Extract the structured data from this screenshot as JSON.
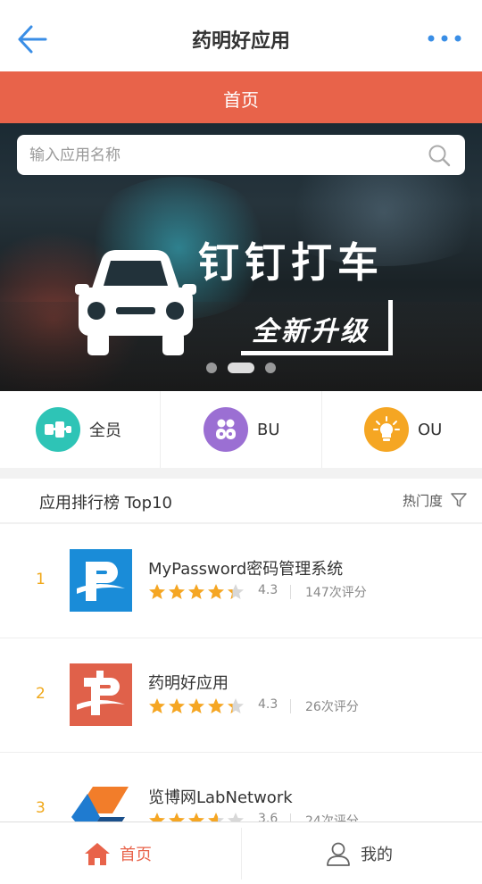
{
  "header": {
    "title": "药明好应用",
    "back_icon": "back-arrow-icon",
    "more_icon": "more-dots-icon"
  },
  "tab": {
    "label": "首页"
  },
  "search": {
    "placeholder": "输入应用名称",
    "value": "",
    "icon": "search-icon"
  },
  "banner": {
    "headline": "钉钉打车",
    "subline": "全新升级",
    "slide_count": 3,
    "active_slide": 2
  },
  "categories": [
    {
      "label": "全员",
      "icon": "people-icon",
      "color": "#2ec4b6"
    },
    {
      "label": "BU",
      "icon": "group-icon",
      "color": "#9b6fd3"
    },
    {
      "label": "OU",
      "icon": "bulb-icon",
      "color": "#f5a623"
    }
  ],
  "ranking": {
    "title": "应用排行榜 Top10",
    "sort_label": "热门度",
    "sort_icon": "filter-icon"
  },
  "apps": [
    {
      "rank": "1",
      "name": "MyPassword密码管理系统",
      "rating": 4.3,
      "score": "4.3",
      "reviews": "147次评分",
      "icon_color": "#1a8cd8"
    },
    {
      "rank": "2",
      "name": "药明好应用",
      "rating": 4.3,
      "score": "4.3",
      "reviews": "26次评分",
      "icon_color": "#e0614a"
    },
    {
      "rank": "3",
      "name": "览博网LabNetwork",
      "rating": 3.6,
      "score": "3.6",
      "reviews": "24次评分",
      "icon_color": "#1f7bd0"
    }
  ],
  "bottom_nav": {
    "home_label": "首页",
    "home_icon": "home-icon",
    "mine_label": "我的",
    "mine_icon": "user-icon",
    "active_color": "#e8634a",
    "inactive_color": "#444444"
  },
  "colors": {
    "accent": "#e8634a",
    "rank": "#f0a81a",
    "star_on": "#f5a623",
    "star_off": "#d8d8d8",
    "back_arrow": "#3a8ee6"
  }
}
